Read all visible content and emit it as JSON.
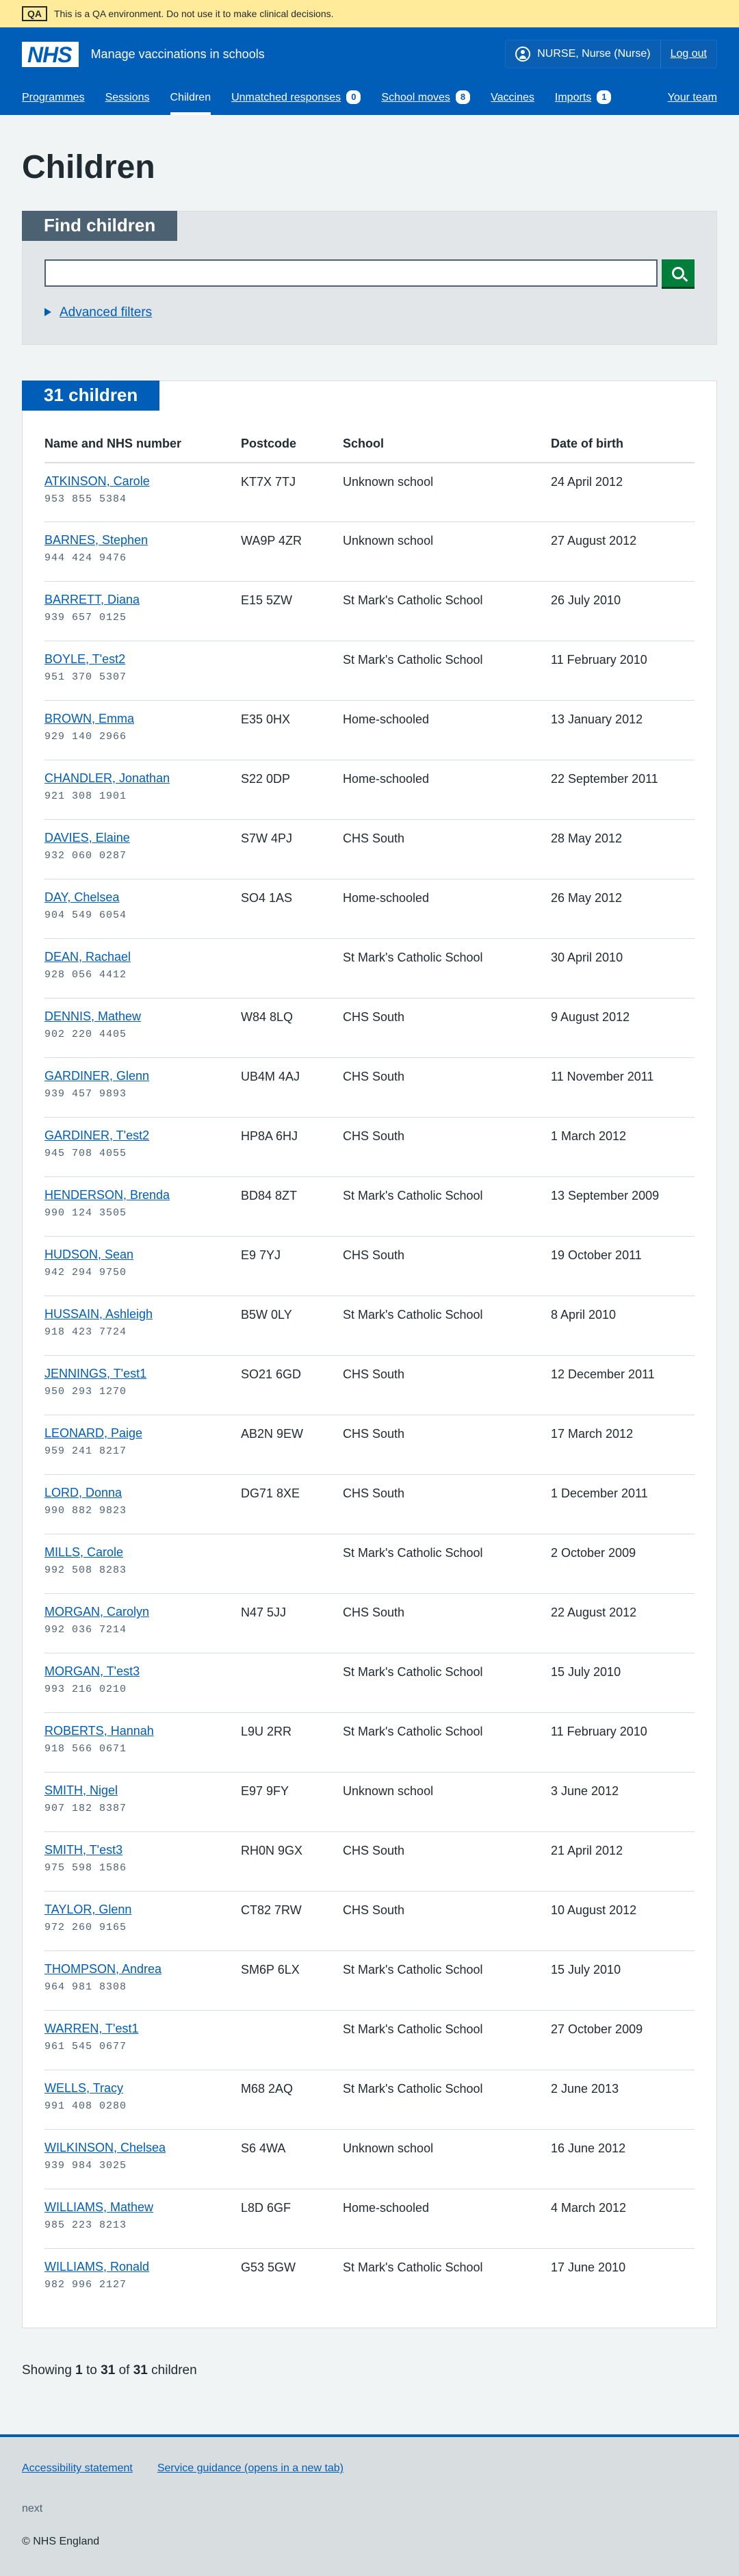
{
  "qa_banner": {
    "tag": "QA",
    "text": "This is a QA environment. Do not use it to make clinical decisions."
  },
  "header": {
    "logo": "NHS",
    "service_name": "Manage vaccinations in schools",
    "user": "NURSE, Nurse (Nurse)",
    "logout": "Log out"
  },
  "nav": [
    {
      "label": "Programmes"
    },
    {
      "label": "Sessions"
    },
    {
      "label": "Children"
    },
    {
      "label": "Unmatched responses",
      "count": "0"
    },
    {
      "label": "School moves",
      "count": "8"
    },
    {
      "label": "Vaccines"
    },
    {
      "label": "Imports",
      "count": "1"
    },
    {
      "label": "Your team"
    }
  ],
  "page_title": "Children",
  "search": {
    "heading": "Find children",
    "input_value": "",
    "button_label": "Search",
    "advanced_filters": "Advanced filters"
  },
  "results": {
    "heading": "31 children",
    "columns": [
      "Name and NHS number",
      "Postcode",
      "School",
      "Date of birth"
    ],
    "rows": [
      {
        "name": "ATKINSON, Carole",
        "nhs": "953 855 5384",
        "postcode": "KT7X 7TJ",
        "school": "Unknown school",
        "dob": "24 April 2012"
      },
      {
        "name": "BARNES, Stephen",
        "nhs": "944 424 9476",
        "postcode": "WA9P 4ZR",
        "school": "Unknown school",
        "dob": "27 August 2012"
      },
      {
        "name": "BARRETT, Diana",
        "nhs": "939 657 0125",
        "postcode": "E15 5ZW",
        "school": "St Mark's Catholic School",
        "dob": "26 July 2010"
      },
      {
        "name": "BOYLE, T'est2",
        "nhs": "951 370 5307",
        "postcode": "",
        "school": "St Mark's Catholic School",
        "dob": "11 February 2010"
      },
      {
        "name": "BROWN, Emma",
        "nhs": "929 140 2966",
        "postcode": "E35 0HX",
        "school": "Home-schooled",
        "dob": "13 January 2012"
      },
      {
        "name": "CHANDLER, Jonathan",
        "nhs": "921 308 1901",
        "postcode": "S22 0DP",
        "school": "Home-schooled",
        "dob": "22 September 2011"
      },
      {
        "name": "DAVIES, Elaine",
        "nhs": "932 060 0287",
        "postcode": "S7W 4PJ",
        "school": "CHS South",
        "dob": "28 May 2012"
      },
      {
        "name": "DAY, Chelsea",
        "nhs": "904 549 6054",
        "postcode": "SO4 1AS",
        "school": "Home-schooled",
        "dob": "26 May 2012"
      },
      {
        "name": "DEAN, Rachael",
        "nhs": "928 056 4412",
        "postcode": "",
        "school": "St Mark's Catholic School",
        "dob": "30 April 2010"
      },
      {
        "name": "DENNIS, Mathew",
        "nhs": "902 220 4405",
        "postcode": "W84 8LQ",
        "school": "CHS South",
        "dob": "9 August 2012"
      },
      {
        "name": "GARDINER, Glenn",
        "nhs": "939 457 9893",
        "postcode": "UB4M 4AJ",
        "school": "CHS South",
        "dob": "11 November 2011"
      },
      {
        "name": "GARDINER, T'est2",
        "nhs": "945 708 4055",
        "postcode": "HP8A 6HJ",
        "school": "CHS South",
        "dob": "1 March 2012"
      },
      {
        "name": "HENDERSON, Brenda",
        "nhs": "990 124 3505",
        "postcode": "BD84 8ZT",
        "school": "St Mark's Catholic School",
        "dob": "13 September 2009"
      },
      {
        "name": "HUDSON, Sean",
        "nhs": "942 294 9750",
        "postcode": "E9 7YJ",
        "school": "CHS South",
        "dob": "19 October 2011"
      },
      {
        "name": "HUSSAIN, Ashleigh",
        "nhs": "918 423 7724",
        "postcode": "B5W 0LY",
        "school": "St Mark's Catholic School",
        "dob": "8 April 2010"
      },
      {
        "name": "JENNINGS, T'est1",
        "nhs": "950 293 1270",
        "postcode": "SO21 6GD",
        "school": "CHS South",
        "dob": "12 December 2011"
      },
      {
        "name": "LEONARD, Paige",
        "nhs": "959 241 8217",
        "postcode": "AB2N 9EW",
        "school": "CHS South",
        "dob": "17 March 2012"
      },
      {
        "name": "LORD, Donna",
        "nhs": "990 882 9823",
        "postcode": "DG71 8XE",
        "school": "CHS South",
        "dob": "1 December 2011"
      },
      {
        "name": "MILLS, Carole",
        "nhs": "992 508 8283",
        "postcode": "",
        "school": "St Mark's Catholic School",
        "dob": "2 October 2009"
      },
      {
        "name": "MORGAN, Carolyn",
        "nhs": "992 036 7214",
        "postcode": "N47 5JJ",
        "school": "CHS South",
        "dob": "22 August 2012"
      },
      {
        "name": "MORGAN, T'est3",
        "nhs": "993 216 0210",
        "postcode": "",
        "school": "St Mark's Catholic School",
        "dob": "15 July 2010"
      },
      {
        "name": "ROBERTS, Hannah",
        "nhs": "918 566 0671",
        "postcode": "L9U 2RR",
        "school": "St Mark's Catholic School",
        "dob": "11 February 2010"
      },
      {
        "name": "SMITH, Nigel",
        "nhs": "907 182 8387",
        "postcode": "E97 9FY",
        "school": "Unknown school",
        "dob": "3 June 2012"
      },
      {
        "name": "SMITH, T'est3",
        "nhs": "975 598 1586",
        "postcode": "RH0N 9GX",
        "school": "CHS South",
        "dob": "21 April 2012"
      },
      {
        "name": "TAYLOR, Glenn",
        "nhs": "972 260 9165",
        "postcode": "CT82 7RW",
        "school": "CHS South",
        "dob": "10 August 2012"
      },
      {
        "name": "THOMPSON, Andrea",
        "nhs": "964 981 8308",
        "postcode": "SM6P 6LX",
        "school": "St Mark's Catholic School",
        "dob": "15 July 2010"
      },
      {
        "name": "WARREN, T'est1",
        "nhs": "961 545 0677",
        "postcode": "",
        "school": "St Mark's Catholic School",
        "dob": "27 October 2009"
      },
      {
        "name": "WELLS, Tracy",
        "nhs": "991 408 0280",
        "postcode": "M68 2AQ",
        "school": "St Mark's Catholic School",
        "dob": "2 June 2013"
      },
      {
        "name": "WILKINSON, Chelsea",
        "nhs": "939 984 3025",
        "postcode": "S6 4WA",
        "school": "Unknown school",
        "dob": "16 June 2012"
      },
      {
        "name": "WILLIAMS, Mathew",
        "nhs": "985 223 8213",
        "postcode": "L8D 6GF",
        "school": "Home-schooled",
        "dob": "4 March 2012"
      },
      {
        "name": "WILLIAMS, Ronald",
        "nhs": "982 996 2127",
        "postcode": "G53 5GW",
        "school": "St Mark's Catholic School",
        "dob": "17 June 2010"
      }
    ]
  },
  "pagination": {
    "prefix": "Showing",
    "from": "1",
    "to_word": "to",
    "to": "31",
    "of_word": "of",
    "total": "31",
    "suffix": "children"
  },
  "footer": {
    "links": [
      "Accessibility statement",
      "Service guidance (opens in a new tab)"
    ],
    "commit": "next",
    "copyright": "© NHS England"
  }
}
